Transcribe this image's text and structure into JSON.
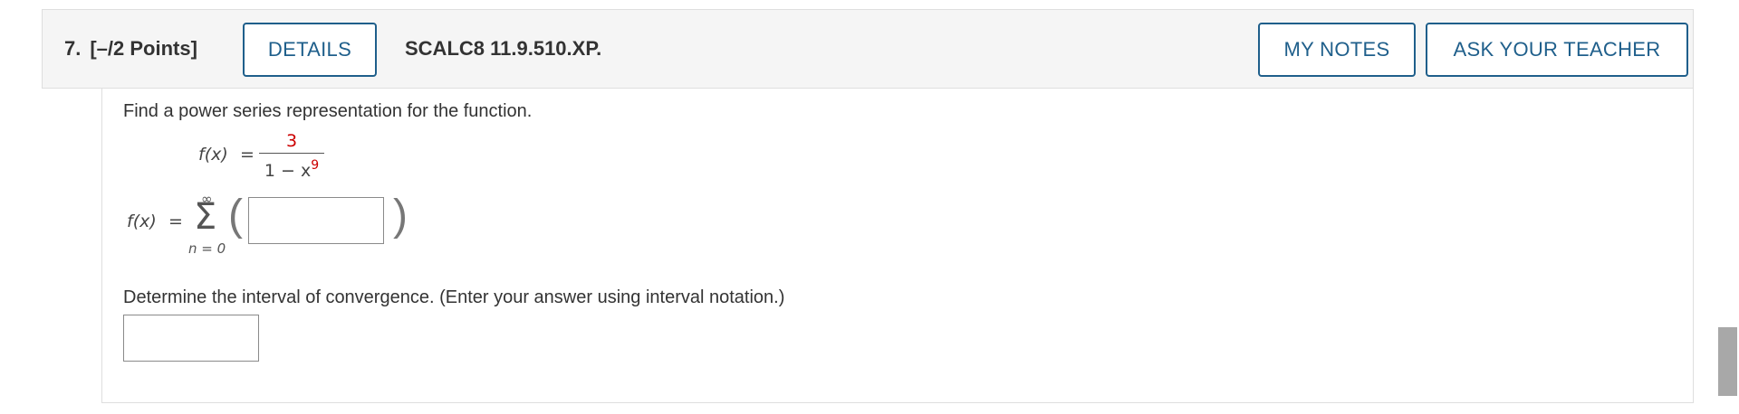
{
  "question": {
    "number": "7.",
    "points": "[–/2 Points]",
    "code": "SCALC8 11.9.510.XP."
  },
  "buttons": {
    "details": "DETAILS",
    "my_notes": "MY NOTES",
    "ask_teacher": "ASK YOUR TEACHER"
  },
  "body": {
    "prompt1": "Find a power series representation for the function.",
    "function_lhs": "f(x)",
    "equals": "=",
    "numerator": "3",
    "denominator_base": "1 − x",
    "denominator_exponent": "9",
    "series_lhs": "f(x)",
    "sum_upper": "∞",
    "sum_symbol": "Σ",
    "sum_lower": "n = 0",
    "paren_open": "(",
    "paren_close": ")",
    "prompt2": "Determine the interval of convergence. (Enter your answer using interval notation.)",
    "series_term_value": "",
    "interval_value": ""
  },
  "colors": {
    "button_blue": "#1f5f8b",
    "highlight_red": "#cc0000",
    "header_bg": "#f5f5f5"
  }
}
